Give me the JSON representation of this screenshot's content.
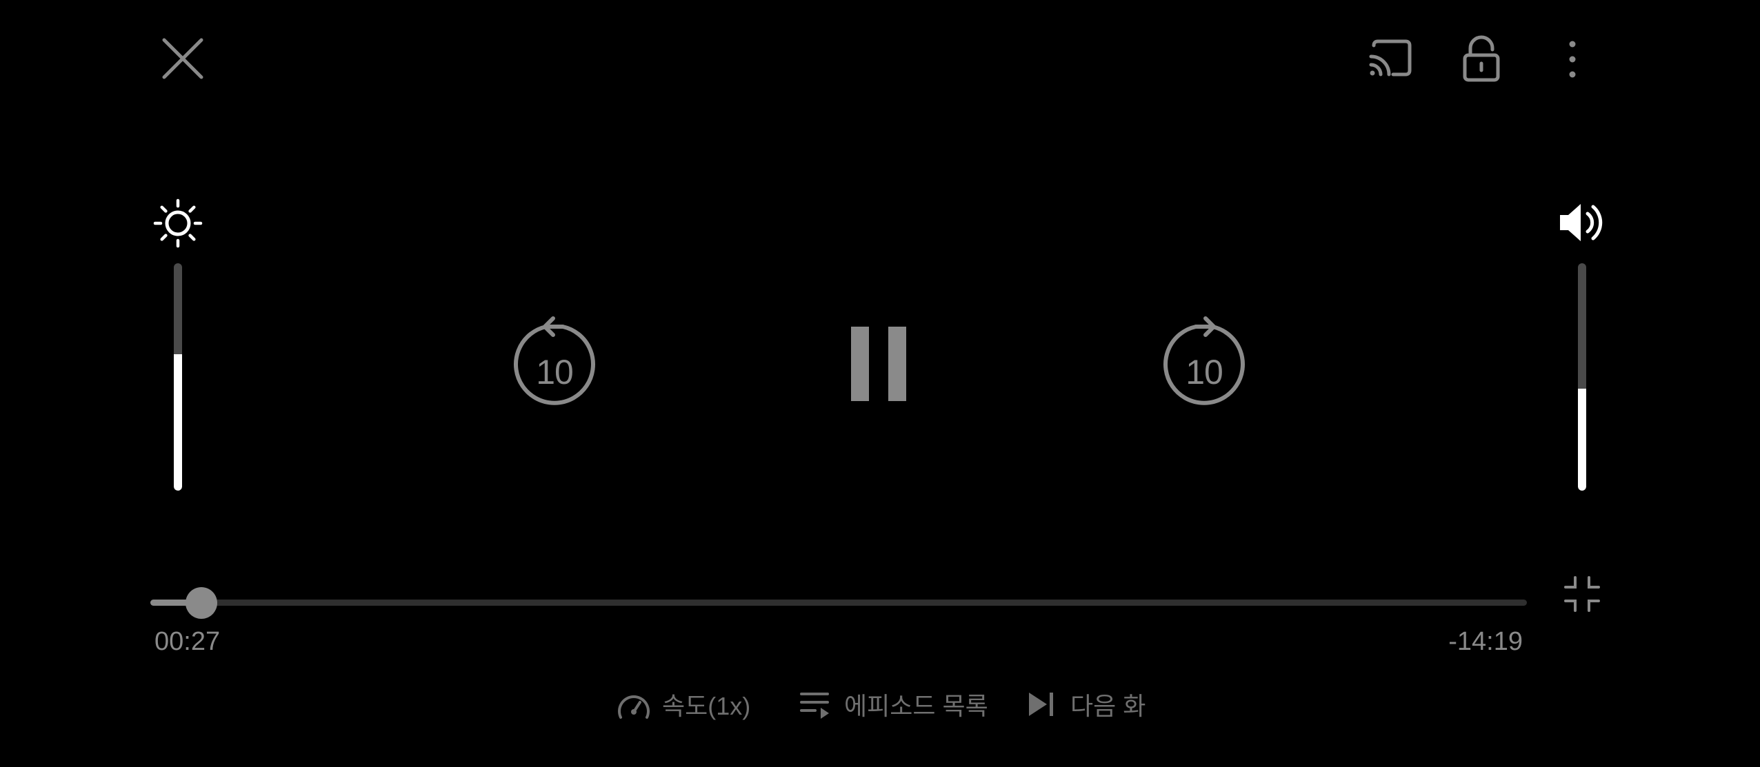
{
  "player": {
    "brightness_level": 0.6,
    "volume_level": 0.45,
    "skip_back_seconds": "10",
    "skip_forward_seconds": "10"
  },
  "progress": {
    "elapsed": "00:27",
    "remaining": "-14:19",
    "fraction": 0.037
  },
  "bottom_menu": {
    "speed_label": "속도(1x)",
    "episodes_label": "에피소드 목록",
    "next_label": "다음 화"
  },
  "icons": {
    "close": "close-icon",
    "cast": "cast-icon",
    "lock": "unlock-icon",
    "more": "more-vertical-icon",
    "brightness": "brightness-icon",
    "volume": "volume-icon",
    "rewind": "replay-10-icon",
    "pause": "pause-icon",
    "forward": "forward-10-icon",
    "minimize": "exit-fullscreen-icon",
    "speed": "speedometer-icon",
    "episodes": "playlist-icon",
    "next": "skip-next-icon"
  },
  "colors": {
    "background": "#000000",
    "icon_dim": "#8a8a8a",
    "label_dim": "#6f6f6f",
    "track": "#2f2f2f",
    "slider_track": "#4a4a4a",
    "active": "#ffffff"
  }
}
